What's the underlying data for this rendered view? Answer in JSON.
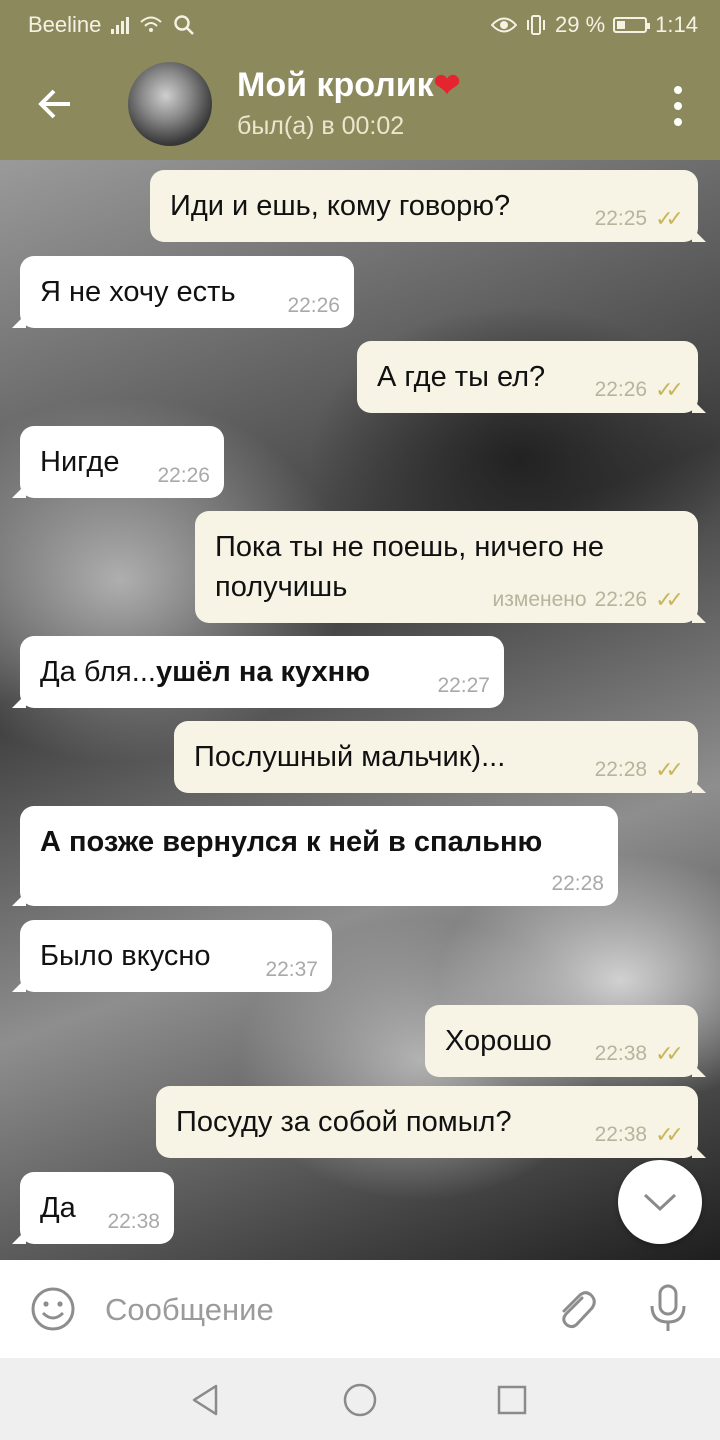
{
  "status_bar": {
    "carrier": "Beeline",
    "battery": "29 %",
    "time": "1:14"
  },
  "header": {
    "title": "Мой кролик",
    "heart": "❤",
    "subtitle": "был(а) в 00:02"
  },
  "messages": [
    {
      "dir": "out",
      "text": "Иди и ешь, кому говорю?",
      "time": "22:25",
      "read": true
    },
    {
      "dir": "in",
      "text": "Я не хочу есть",
      "time": "22:26"
    },
    {
      "dir": "out",
      "text": "А где ты ел?",
      "time": "22:26",
      "read": true
    },
    {
      "dir": "in",
      "text": "Нигде",
      "time": "22:26"
    },
    {
      "dir": "out",
      "line1": "Пока ты не поешь, ничего не",
      "line2": "получишь",
      "edited": "изменено",
      "time": "22:26",
      "read": true
    },
    {
      "dir": "in",
      "text_plain": "Да бля...",
      "text_bold": "ушёл на кухню",
      "time": "22:27"
    },
    {
      "dir": "out",
      "text": "Послушный мальчик)...",
      "time": "22:28",
      "read": true
    },
    {
      "dir": "in",
      "text_bold": "А позже вернулся к ней в спальню",
      "time": "22:28"
    },
    {
      "dir": "in",
      "text": "Было вкусно",
      "time": "22:37"
    },
    {
      "dir": "out",
      "text": "Хорошо",
      "time": "22:38",
      "read": true
    },
    {
      "dir": "out",
      "text": "Посуду за собой помыл?",
      "time": "22:38",
      "read": true
    },
    {
      "dir": "in",
      "text": "Да",
      "time": "22:38"
    }
  ],
  "input": {
    "placeholder": "Сообщение"
  },
  "colors": {
    "header": "#8c8a5c",
    "bubble_out": "#f7f4e6",
    "bubble_in": "#ffffff",
    "check": "#c9b65a"
  }
}
